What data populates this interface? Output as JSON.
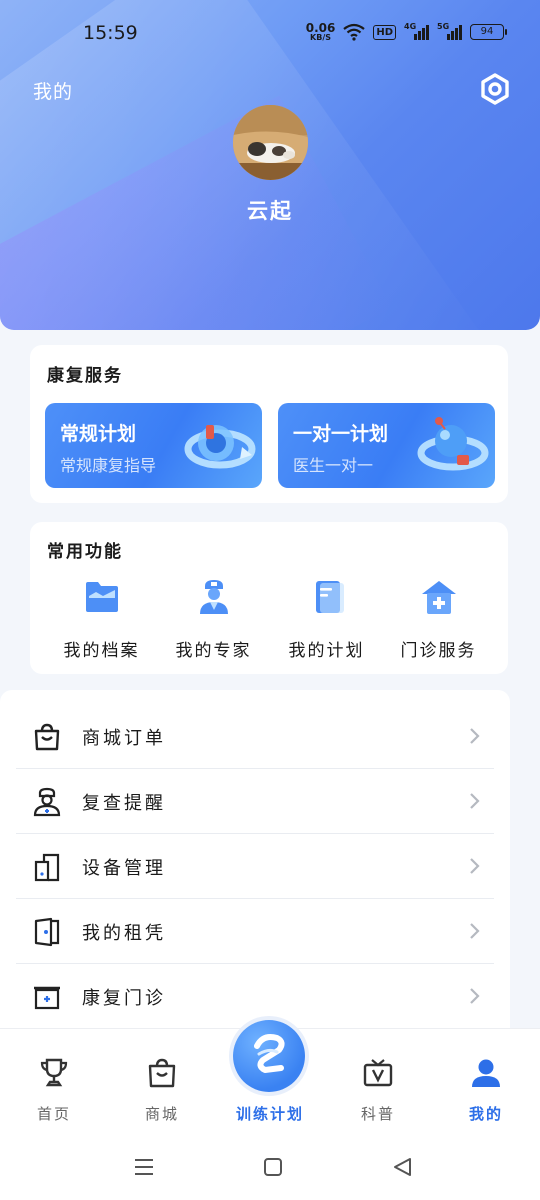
{
  "status_bar": {
    "time": "15:59",
    "net_speed": "0.06",
    "net_unit": "KB/S",
    "hd": "HD",
    "sig1_label": "4G",
    "sig2_label": "5G",
    "battery": "94"
  },
  "header": {
    "title": "我的",
    "username": "云起"
  },
  "rehab_services": {
    "title": "康复服务",
    "cards": [
      {
        "title": "常规计划",
        "subtitle": "常规康复指导"
      },
      {
        "title": "一对一计划",
        "subtitle": "医生一对一"
      }
    ]
  },
  "common_functions": {
    "title": "常用功能",
    "items": [
      {
        "label": "我的档案",
        "icon": "folder-icon"
      },
      {
        "label": "我的专家",
        "icon": "doctor-icon"
      },
      {
        "label": "我的计划",
        "icon": "document-icon"
      },
      {
        "label": "门诊服务",
        "icon": "clinic-icon"
      }
    ]
  },
  "menu_list": [
    {
      "label": "商城订单",
      "icon": "shopping-bag-icon"
    },
    {
      "label": "复查提醒",
      "icon": "nurse-icon"
    },
    {
      "label": "设备管理",
      "icon": "device-icon"
    },
    {
      "label": "我的租凭",
      "icon": "door-icon"
    },
    {
      "label": "康复门诊",
      "icon": "medical-kit-icon"
    }
  ],
  "tab_bar": {
    "tabs": [
      {
        "label": "首页",
        "icon": "trophy-icon"
      },
      {
        "label": "商城",
        "icon": "bag-icon"
      },
      {
        "label": "训练计划",
        "icon": "logo-icon"
      },
      {
        "label": "科普",
        "icon": "tv-icon"
      },
      {
        "label": "我的",
        "icon": "person-icon"
      }
    ],
    "active": "我的"
  },
  "colors": {
    "accent": "#2d6fe8",
    "header_start": "#8fb3f7",
    "header_end": "#4d78ec",
    "card_blue": "#3a7df5"
  }
}
